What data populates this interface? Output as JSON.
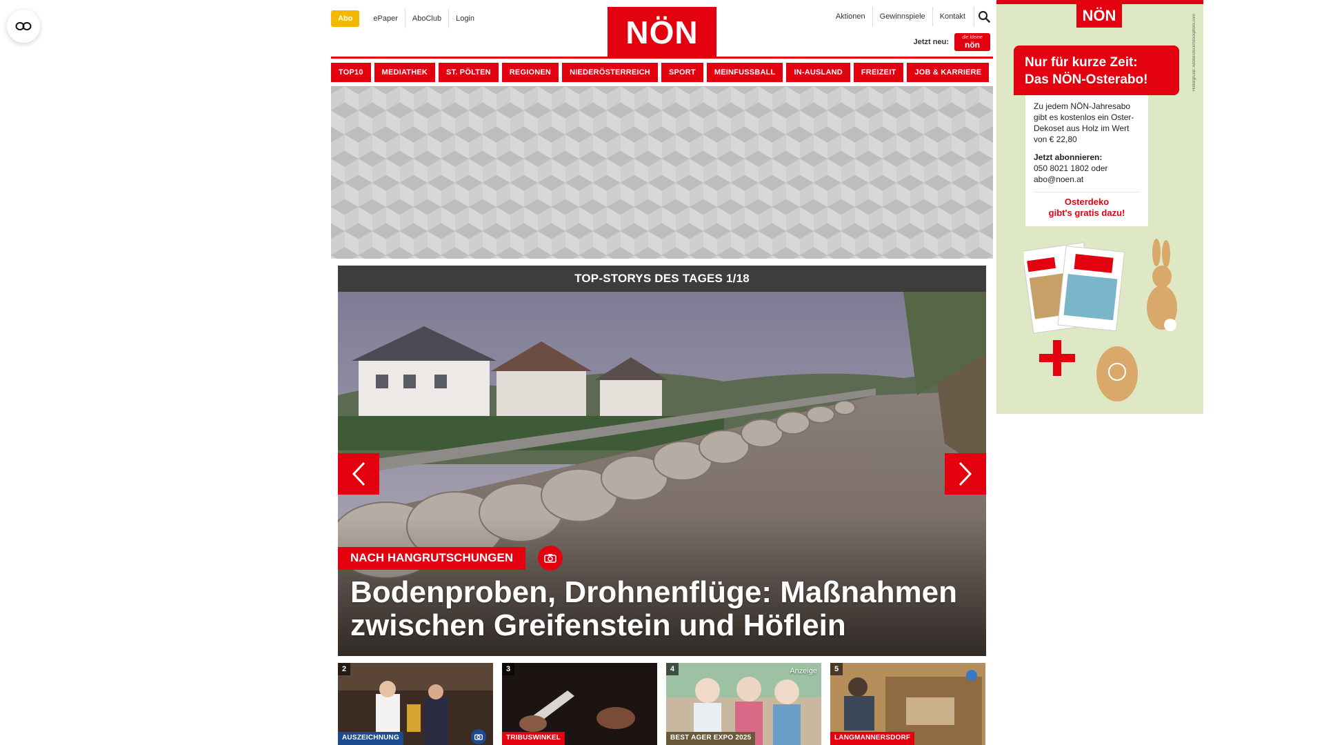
{
  "reader": {
    "icon": "reader-glasses-icon"
  },
  "header": {
    "abo_label": "Abo",
    "left_links": [
      "ePaper",
      "AboClub",
      "Login"
    ],
    "logo_text": "NÖN",
    "right_links": [
      "Aktionen",
      "Gewinnspiele",
      "Kontakt"
    ],
    "search_icon": "search-icon",
    "jetzt_label": "Jetzt neu:",
    "mini_logo_small": "die kleine",
    "mini_logo_big": "nön"
  },
  "nav": [
    "TOP10",
    "MEDIATHEK",
    "ST. PÖLTEN",
    "REGIONEN",
    "NIEDERÖSTERREICH",
    "SPORT",
    "MEINFUSSBALL",
    "IN-AUSLAND",
    "FREIZEIT",
    "JOB & KARRIERE"
  ],
  "stories": {
    "heading": "TOP-STORYS DES TAGES 1/18",
    "hero": {
      "kicker": "NACH HANGRUTSCHUNGEN",
      "title": "Bodenproben, Drohnenflüge: Maßnahmen zwischen Greifenstein und Höflein",
      "prev_icon": "chevron-left-icon",
      "next_icon": "chevron-right-icon",
      "gallery_icon": "camera-icon"
    },
    "thumbs": [
      {
        "num": "2",
        "tag": "AUSZEICHNUNG",
        "tag_color": "#1d4b8f",
        "has_camera": true
      },
      {
        "num": "3",
        "tag": "TRIBUSWINKEL",
        "tag_color": "#e3000f"
      },
      {
        "num": "4",
        "tag": "BEST AGER EXPO 2025",
        "tag_color": "#6b5a3a",
        "badge": "Anzeige"
      },
      {
        "num": "5",
        "tag": "LANGMANNERSDORF",
        "tag_color": "#e3000f"
      }
    ]
  },
  "side_ad": {
    "logo": "NÖN",
    "credit": "Hintergrund: AdobeStock/fstockphoto.com",
    "promo_line1": "Nur für kurze Zeit:",
    "promo_line2": "Das NÖN-Osterabo!",
    "body": "Zu jedem NÖN-Jahresabo gibt es kostenlos ein Oster-Dekoset aus Holz im Wert von € 22,80",
    "cta_title": "Jetzt abonnieren:",
    "cta_phone": "050 8021 1802 oder",
    "cta_mail": "abo@noen.at",
    "highlight_1": "Osterdeko",
    "highlight_2": "gibt's gratis dazu!"
  },
  "colors": {
    "brand_red": "#e3000f",
    "abo_yellow": "#f5b800",
    "dark_bar": "#3d3d3d",
    "ad_green": "#dfe8c4"
  }
}
